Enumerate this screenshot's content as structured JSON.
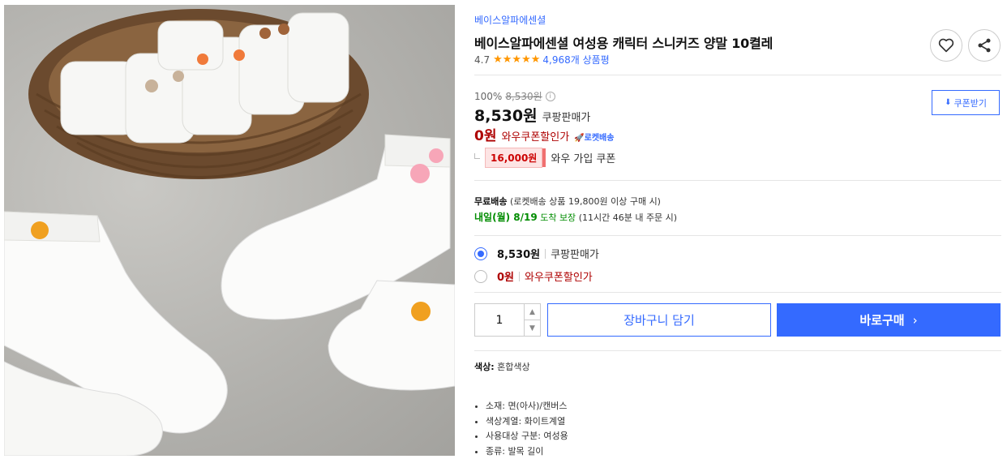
{
  "product": {
    "brand": "베이스알파에센셜",
    "title": "베이스알파에센셜 여성용 캐릭터 스니커즈 양말 10켤레",
    "rating": "4.7",
    "stars_filled": 5,
    "review_count": "4,968개 상품평"
  },
  "price": {
    "discount_rate": "100%",
    "original": "8,530원",
    "sale": "8,530원",
    "sale_label": "쿠팡판매가",
    "wow": "0원",
    "wow_label": "와우쿠폰할인가",
    "rocket_badge": "로켓배송",
    "join_coupon": "16,000원",
    "join_coupon_label": "와우 가입 쿠폰",
    "coupon_button": "쿠폰받기"
  },
  "shipping": {
    "free_label": "무료배송",
    "free_detail": "(로켓배송 상품 19,800원 이상 구매 시)",
    "arrival": "내일(월) 8/19",
    "arrival_suffix": "도착 보장",
    "arrival_note": "(11시간 46분 내 주문 시)"
  },
  "options": [
    {
      "price": "8,530원",
      "label": "쿠팡판매가",
      "selected": true
    },
    {
      "price": "0원",
      "label": "와우쿠폰할인가",
      "selected": false
    }
  ],
  "purchase": {
    "quantity": "1",
    "cart_label": "장바구니 담기",
    "buy_label": "바로구매"
  },
  "attributes": {
    "color_label": "색상:",
    "color_value": "혼합색상",
    "specs": [
      "소재: 면(아사)/캔버스",
      "색상계열: 화이트계열",
      "사용대상 구분: 여성용",
      "종류: 발목 길이"
    ]
  },
  "icons": {
    "heart": "heart-icon",
    "share": "share-icon",
    "star": "star-icon",
    "info": "info-icon",
    "download": "download-icon",
    "rocket": "rocket-icon",
    "chevron": "chevron-right-icon"
  },
  "colors": {
    "accent": "#346aff",
    "wow_red": "#ae0000",
    "star": "#ff9600",
    "green": "#008c00"
  }
}
